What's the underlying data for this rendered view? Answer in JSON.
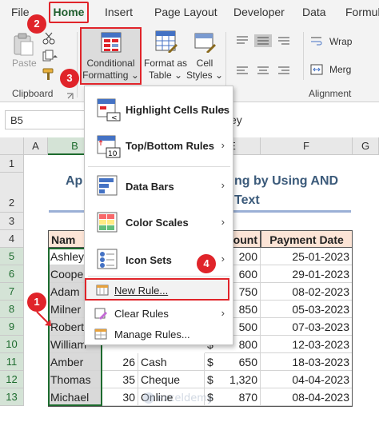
{
  "tabs": [
    "File",
    "Home",
    "Insert",
    "Page Layout",
    "Developer",
    "Data",
    "Formul"
  ],
  "ribbon": {
    "paste": "Paste",
    "conditional_formatting": [
      "Conditional",
      "Formatting"
    ],
    "format_as_table": [
      "Format as",
      "Table"
    ],
    "cell_styles": [
      "Cell",
      "Styles"
    ],
    "wrap": "Wrap",
    "merge": "Merg",
    "group_clipboard": "Clipboard",
    "group_alignment": "Alignment"
  },
  "formula_bar": {
    "name_box": "B5",
    "content": "ey"
  },
  "columns": [
    "A",
    "B",
    "C",
    "D",
    "E",
    "F",
    "G"
  ],
  "rows": [
    "1",
    "2",
    "3",
    "4",
    "5",
    "6",
    "7",
    "8",
    "9",
    "10",
    "11",
    "12",
    "13"
  ],
  "title": {
    "left": "Ap",
    "right": "ng by Using AND",
    "line2": "Text"
  },
  "table": {
    "headers": {
      "name": "Nam",
      "amount": "ount",
      "payment_date": "Payment Date"
    },
    "rows": [
      {
        "name": "Ashley",
        "age": "",
        "method": "",
        "cur": "",
        "amount": "200",
        "date": "25-01-2023"
      },
      {
        "name": "Coope",
        "age": "",
        "method": "",
        "cur": "",
        "amount": "600",
        "date": "29-01-2023"
      },
      {
        "name": "Adam",
        "age": "",
        "method": "",
        "cur": "",
        "amount": "750",
        "date": "08-02-2023"
      },
      {
        "name": "Milner",
        "age": "",
        "method": "",
        "cur": "",
        "amount": "850",
        "date": "05-03-2023"
      },
      {
        "name": "Robert",
        "age": "",
        "method": "",
        "cur": "",
        "amount": "500",
        "date": "07-03-2023"
      },
      {
        "name": "William",
        "age": "",
        "method": "",
        "cur": "$",
        "amount": "800",
        "date": "12-03-2023"
      },
      {
        "name": "Amber",
        "age": "26",
        "method": "Cash",
        "cur": "$",
        "amount": "650",
        "date": "18-03-2023"
      },
      {
        "name": "Thomas",
        "age": "35",
        "method": "Cheque",
        "cur": "$",
        "amount": "1,320",
        "date": "04-04-2023"
      },
      {
        "name": "Michael",
        "age": "30",
        "method": "Online",
        "cur": "$",
        "amount": "870",
        "date": "08-04-2023"
      }
    ]
  },
  "menu": {
    "highlight": "Highlight Cells Rules",
    "topbottom": "Top/Bottom Rules",
    "databars": "Data Bars",
    "colorscales": "Color Scales",
    "iconsets": "Icon Sets",
    "newrule": "New Rule...",
    "clearrules": "Clear Rules",
    "managerules": "Manage Rules..."
  },
  "steps": [
    "1",
    "2",
    "3",
    "4"
  ],
  "colors": {
    "accent_red": "#e0242a",
    "excel_green": "#1d6b2e",
    "header_fill": "#fce4d6"
  }
}
